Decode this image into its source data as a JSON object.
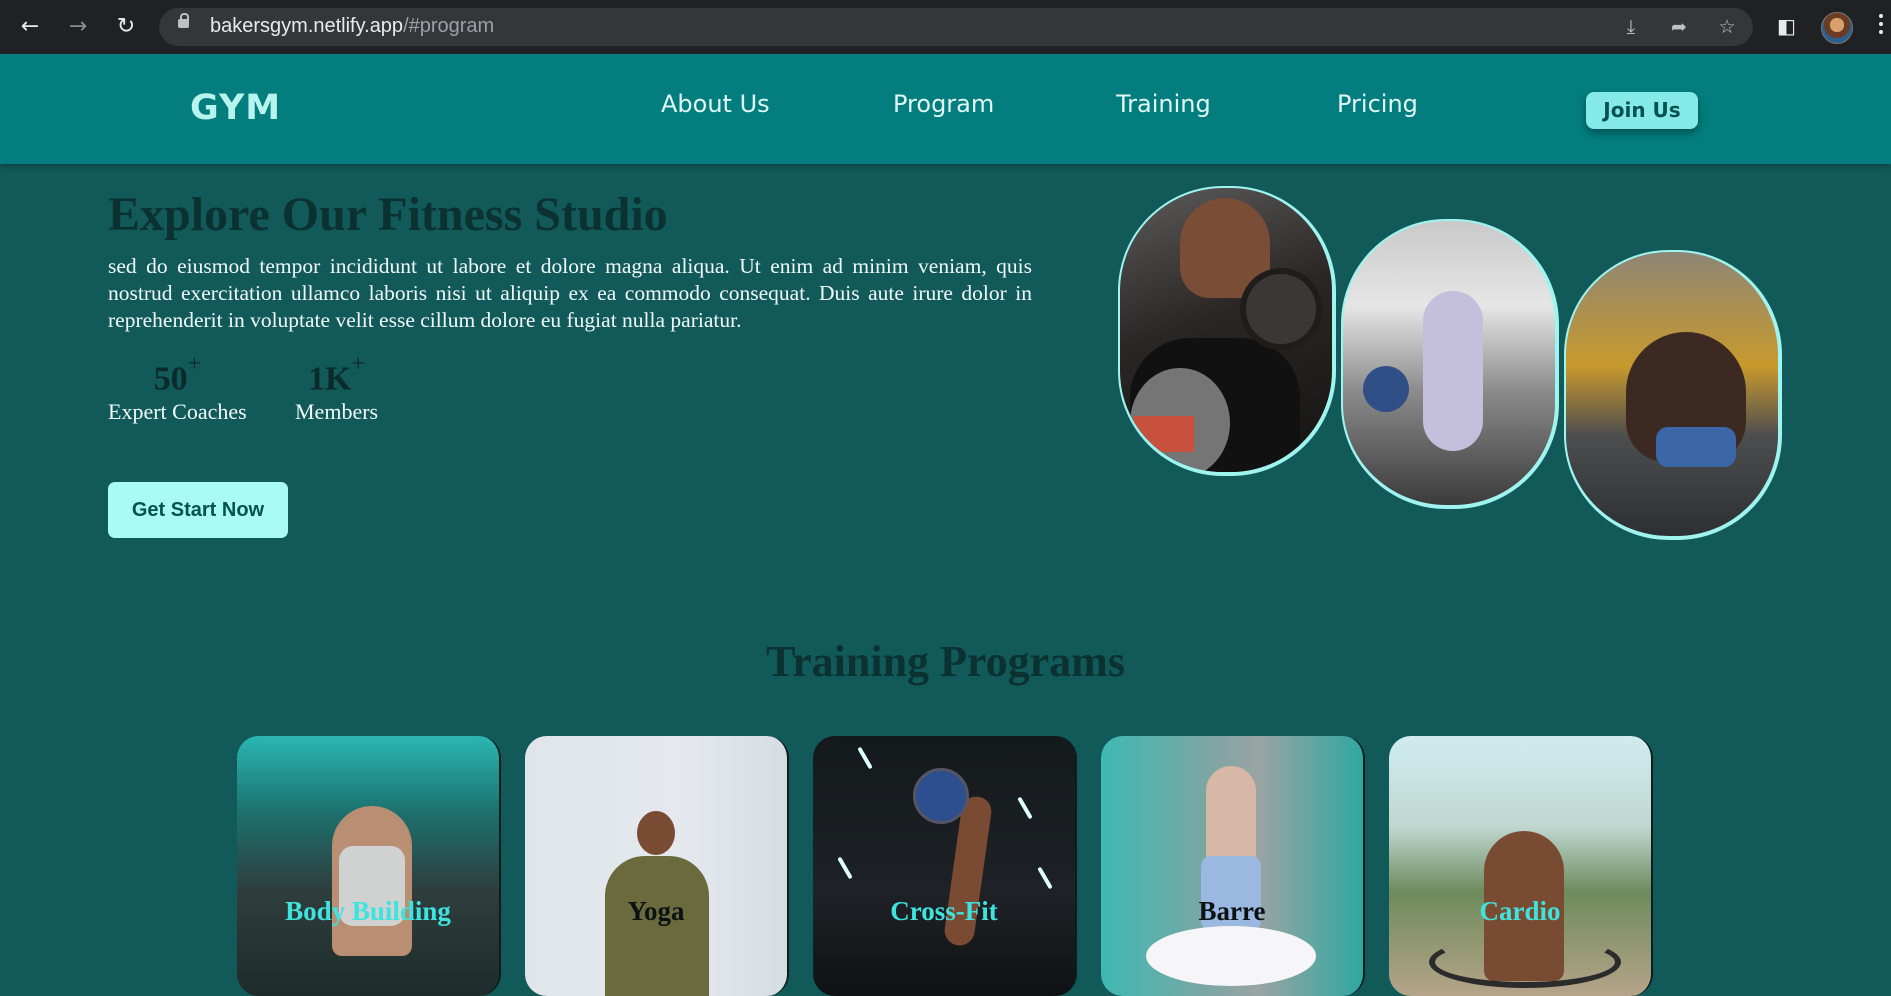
{
  "browser": {
    "url_host": "bakersgym.netlify.app",
    "url_path": "/#program"
  },
  "header": {
    "logo": "GYM",
    "nav": [
      "About Us",
      "Program",
      "Training",
      "Pricing"
    ],
    "join_label": "Join Us"
  },
  "hero": {
    "title": "Explore Our Fitness Studio",
    "text": "sed do eiusmod tempor incididunt ut labore et dolore magna aliqua. Ut enim ad minim veniam, quis nostrud exercitation ullamco laboris nisi ut aliquip ex ea commodo consequat. Duis aute irure dolor in reprehenderit in voluptate velit esse cillum dolore eu fugiat nulla pariatur.",
    "stats": [
      {
        "value": "50",
        "suffix": "+",
        "label": "Expert Coaches"
      },
      {
        "value": "1K",
        "suffix": "+",
        "label": "Members"
      }
    ],
    "cta_label": "Get Start Now"
  },
  "programs": {
    "title": "Training Programs",
    "cards": [
      {
        "label": "Body Building",
        "label_color": "#3fe3dd"
      },
      {
        "label": "Yoga",
        "label_color": "#0b1212"
      },
      {
        "label": "Cross-Fit",
        "label_color": "#3fe3dd"
      },
      {
        "label": "Barre",
        "label_color": "#0b1212"
      },
      {
        "label": "Cardio",
        "label_color": "#3fe3dd"
      }
    ]
  },
  "colors": {
    "page_bg": "#125a5a",
    "header_bg": "#037d7d",
    "accent": "#a9fbf8",
    "title_dark": "#0b3131"
  }
}
